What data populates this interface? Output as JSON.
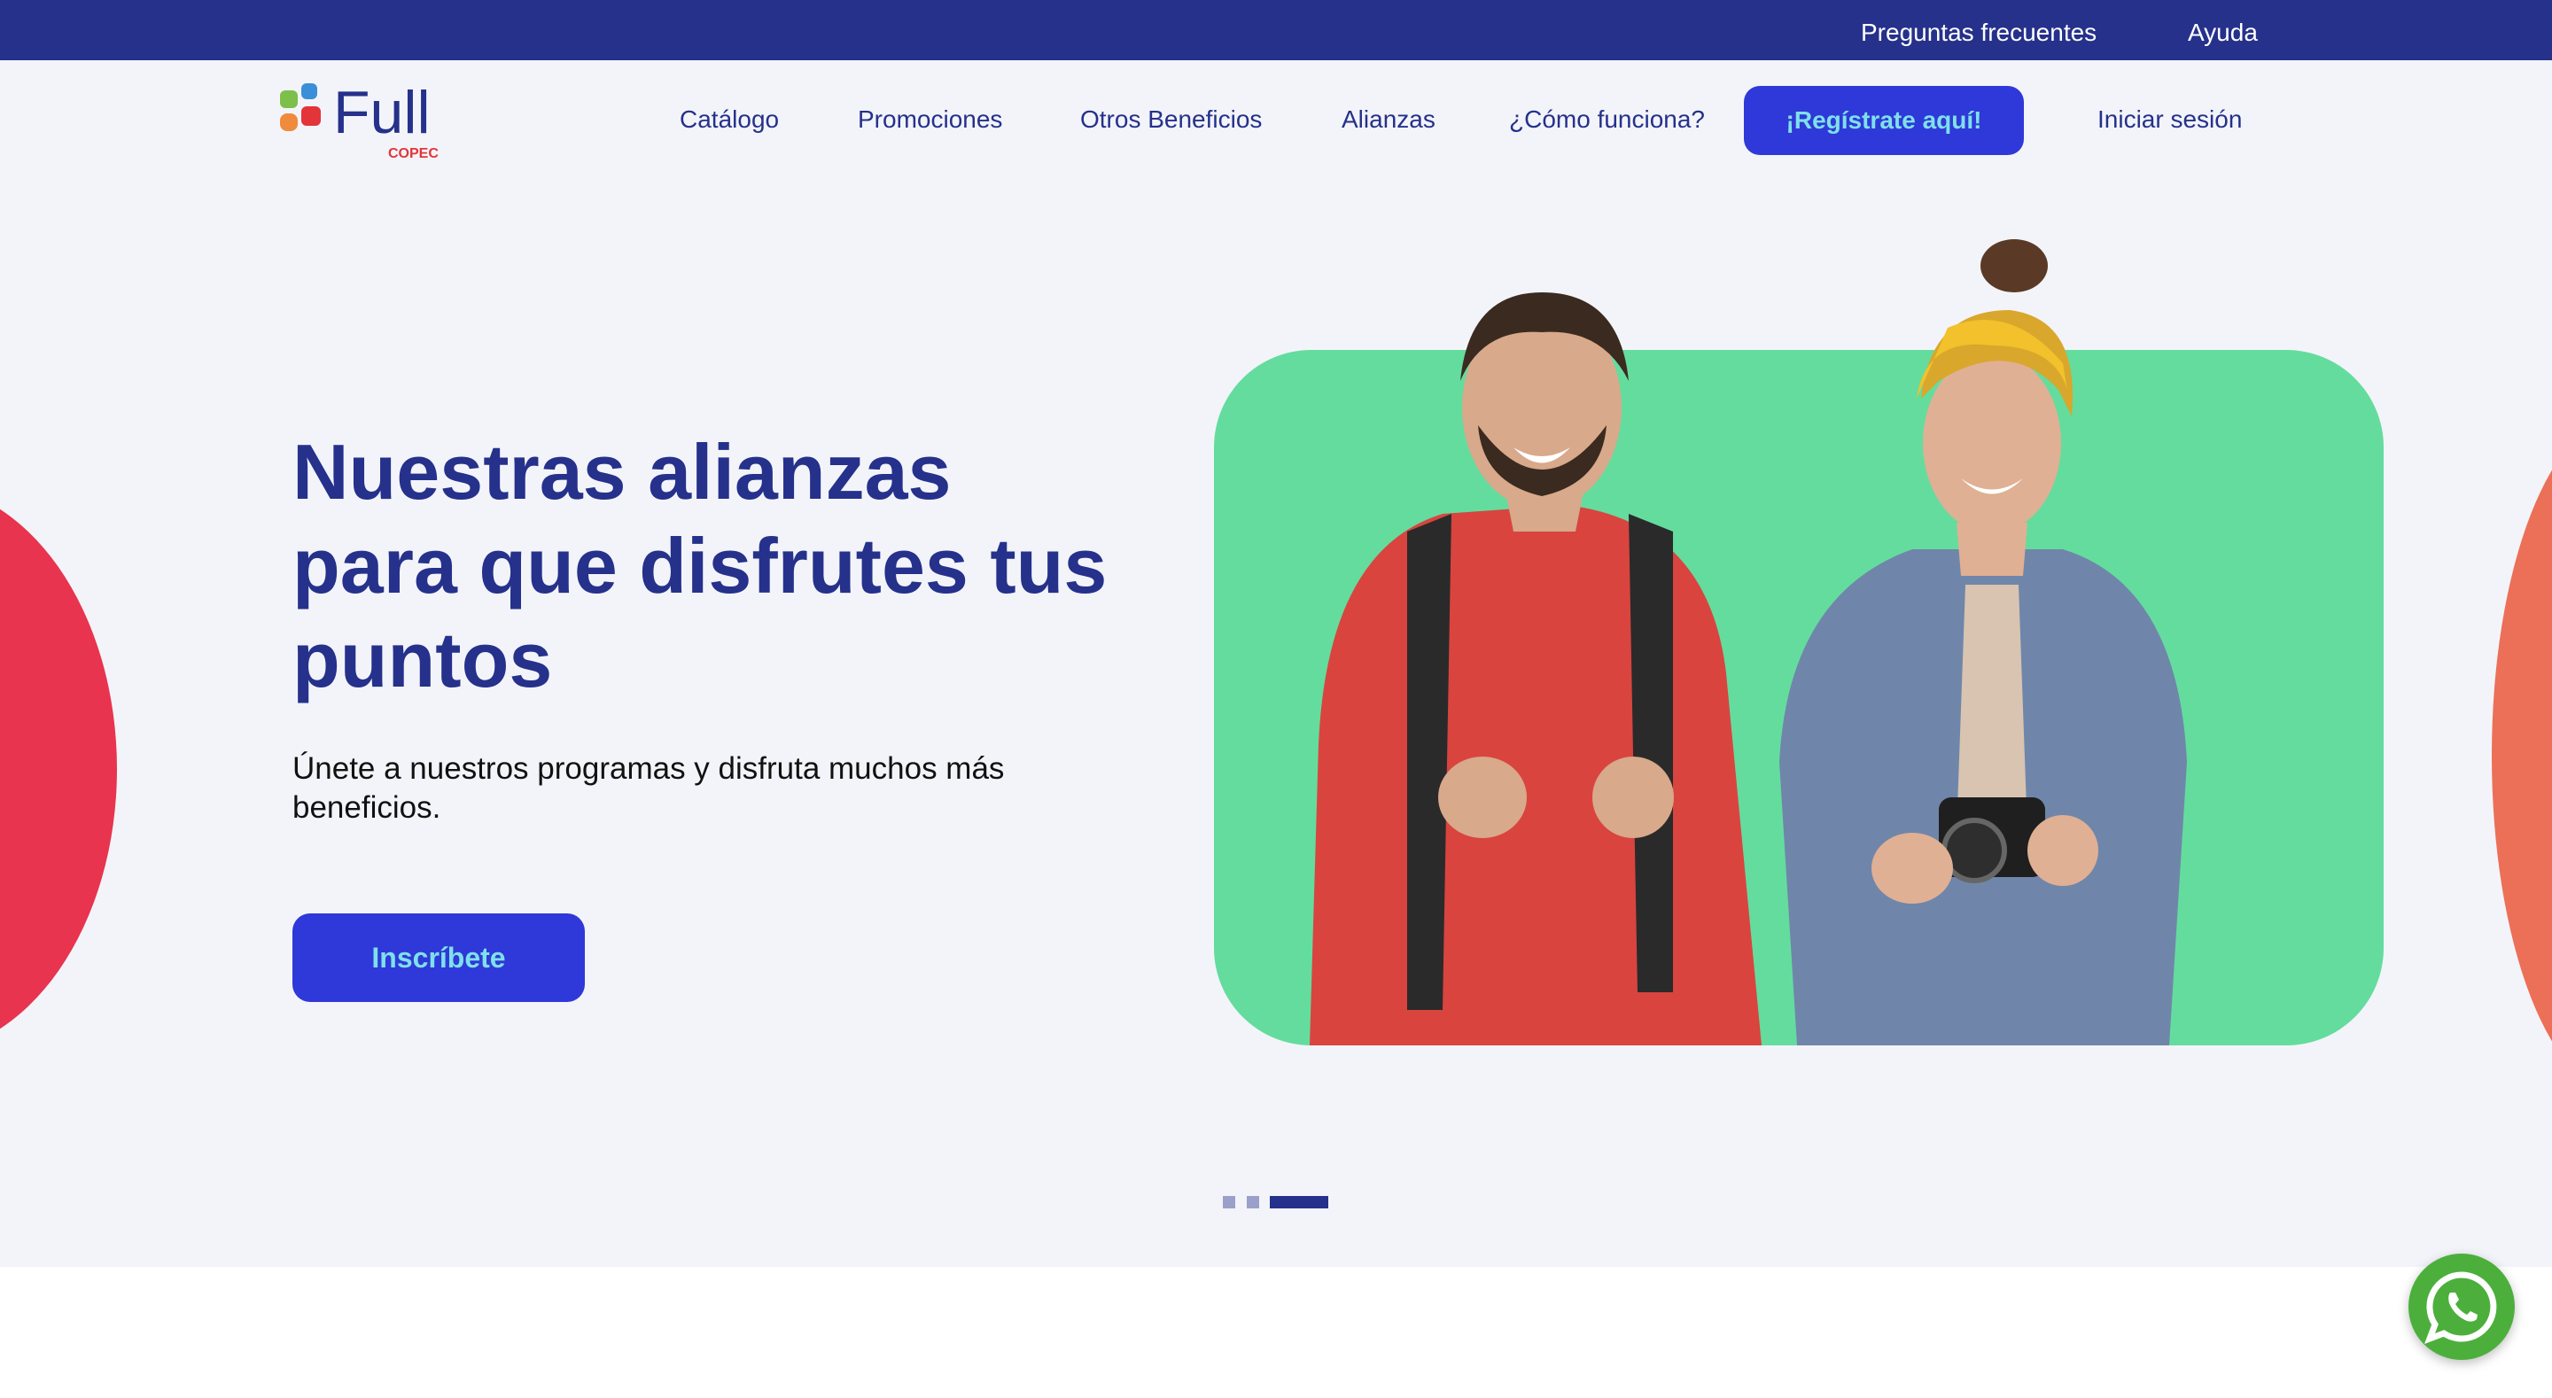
{
  "topbar": {
    "faq_label": "Preguntas frecuentes",
    "help_label": "Ayuda",
    "background": "#25318b"
  },
  "header": {
    "logo_text": "Full",
    "logo_subtext": "COPEC",
    "nav": [
      {
        "label": "Catálogo"
      },
      {
        "label": "Promociones"
      },
      {
        "label": "Otros Beneficios"
      },
      {
        "label": "Alianzas"
      },
      {
        "label": "¿Cómo funciona?"
      }
    ],
    "register_label": "¡Regístrate aquí!",
    "login_label": "Iniciar sesión"
  },
  "hero": {
    "title": "Nuestras alianzas para que disfrutes tus puntos",
    "subtitle": "Únete a nuestros programas y disfruta muchos más beneficios.",
    "cta_label": "Inscríbete",
    "image_icon": "couple-with-backpack-and-camera-photo",
    "carousel": {
      "slides": 3,
      "active": 3
    }
  },
  "floating": {
    "whatsapp_icon": "whatsapp-icon"
  },
  "colors": {
    "brand_navy": "#25318b",
    "button_blue": "#2f38d8",
    "button_text": "#7fe0ea",
    "hero_green": "#64dc9e",
    "deco_red": "#e8344e",
    "deco_orange": "#ec6f58",
    "hero_bg": "#f3f4f9",
    "whatsapp_green": "#4caf3c"
  }
}
